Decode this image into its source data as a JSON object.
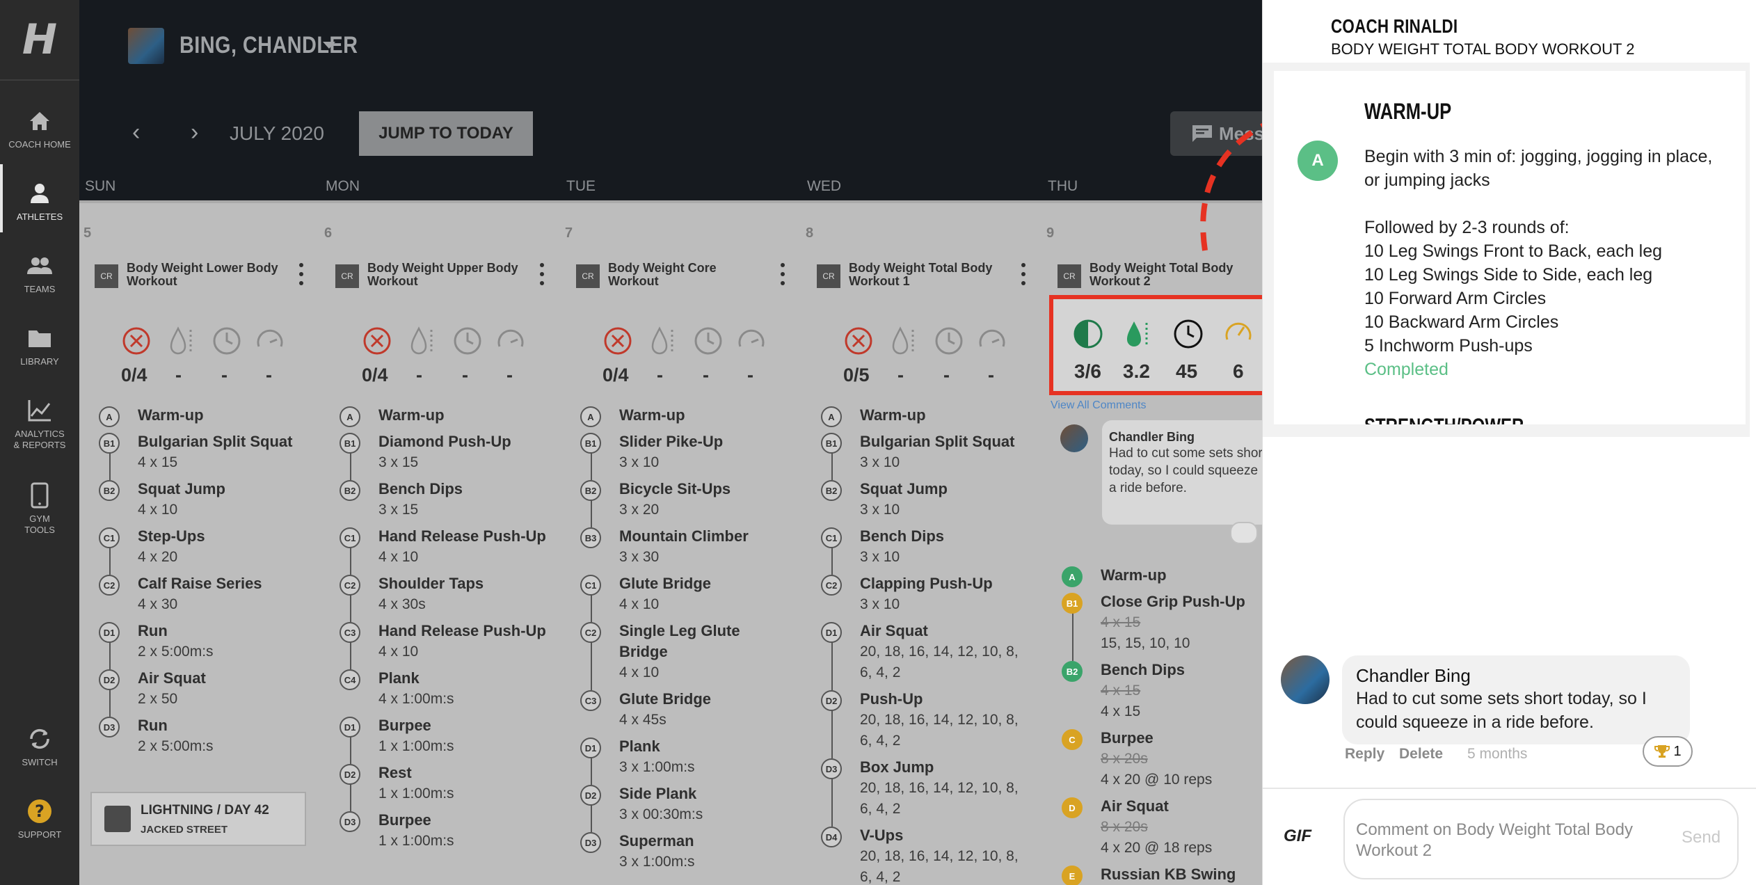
{
  "sidebar": {
    "logo": "H",
    "items": [
      {
        "label_1": "COACH HOME",
        "label_2": ""
      },
      {
        "label_1": "ATHLETES",
        "label_2": ""
      },
      {
        "label_1": "TEAMS",
        "label_2": ""
      },
      {
        "label_1": "LIBRARY",
        "label_2": ""
      },
      {
        "label_1": "ANALYTICS",
        "label_2": "& REPORTS"
      },
      {
        "label_1": "GYM",
        "label_2": "TOOLS"
      },
      {
        "label_1": "SWITCH",
        "label_2": ""
      },
      {
        "label_1": "SUPPORT",
        "label_2": ""
      }
    ]
  },
  "header": {
    "athlete_name": "BING, CHANDLER",
    "month": "JULY 2020",
    "prev_icon": "‹",
    "next_icon": "›",
    "jump_label": "JUMP TO TODAY",
    "message_label": "Mess"
  },
  "days": [
    "SUN",
    "MON",
    "TUE",
    "WED",
    "THU"
  ],
  "columns": [
    {
      "date": "5",
      "badge": "CR",
      "title": "Body Weight Lower Body Workout",
      "stats": [
        "0/4",
        "-",
        "-",
        "-"
      ],
      "exercises": [
        {
          "id": "A",
          "name": "Warm-up",
          "sets": ""
        },
        {
          "id": "B1",
          "name": "Bulgarian Split Squat",
          "sets": "4 x 15"
        },
        {
          "id": "B2",
          "name": "Squat Jump",
          "sets": "4 x 10"
        },
        {
          "id": "C1",
          "name": "Step-Ups",
          "sets": "4 x 20"
        },
        {
          "id": "C2",
          "name": "Calf Raise Series",
          "sets": "4 x 30"
        },
        {
          "id": "D1",
          "name": "Run",
          "sets": "2 x 5:00m:s"
        },
        {
          "id": "D2",
          "name": "Air Squat",
          "sets": "2 x 50"
        },
        {
          "id": "D3",
          "name": "Run",
          "sets": "2 x 5:00m:s"
        }
      ],
      "program": {
        "line1": "LIGHTNING / DAY 42",
        "line2": "JACKED STREET"
      }
    },
    {
      "date": "6",
      "badge": "CR",
      "title": "Body Weight Upper Body Workout",
      "stats": [
        "0/4",
        "-",
        "-",
        "-"
      ],
      "exercises": [
        {
          "id": "A",
          "name": "Warm-up",
          "sets": ""
        },
        {
          "id": "B1",
          "name": "Diamond Push-Up",
          "sets": "3 x 15"
        },
        {
          "id": "B2",
          "name": "Bench Dips",
          "sets": "3 x 15"
        },
        {
          "id": "C1",
          "name": "Hand Release Push-Up",
          "sets": "4 x 10"
        },
        {
          "id": "C2",
          "name": "Shoulder Taps",
          "sets": "4 x 30s"
        },
        {
          "id": "C3",
          "name": "Hand Release Push-Up",
          "sets": "4 x 10"
        },
        {
          "id": "C4",
          "name": "Plank",
          "sets": "4 x 1:00m:s"
        },
        {
          "id": "D1",
          "name": "Burpee",
          "sets": "1 x 1:00m:s"
        },
        {
          "id": "D2",
          "name": "Rest",
          "sets": "1 x 1:00m:s"
        },
        {
          "id": "D3",
          "name": "Burpee",
          "sets": "1 x 1:00m:s"
        }
      ]
    },
    {
      "date": "7",
      "badge": "CR",
      "title": "Body Weight Core Workout",
      "stats": [
        "0/4",
        "-",
        "-",
        "-"
      ],
      "exercises": [
        {
          "id": "A",
          "name": "Warm-up",
          "sets": ""
        },
        {
          "id": "B1",
          "name": "Slider Pike-Up",
          "sets": "3 x 10"
        },
        {
          "id": "B2",
          "name": "Bicycle Sit-Ups",
          "sets": "3 x 20"
        },
        {
          "id": "B3",
          "name": "Mountain Climber",
          "sets": "3 x 30"
        },
        {
          "id": "C1",
          "name": "Glute Bridge",
          "sets": "4 x 10"
        },
        {
          "id": "C2",
          "name": "Single Leg Glute Bridge",
          "sets": "4 x 10"
        },
        {
          "id": "C3",
          "name": "Glute Bridge",
          "sets": "4 x 45s"
        },
        {
          "id": "D1",
          "name": "Plank",
          "sets": "3 x 1:00m:s"
        },
        {
          "id": "D2",
          "name": "Side Plank",
          "sets": "3 x 00:30m:s"
        },
        {
          "id": "D3",
          "name": "Superman",
          "sets": "3 x 1:00m:s"
        }
      ]
    },
    {
      "date": "8",
      "badge": "CR",
      "title": "Body Weight Total Body Workout 1",
      "stats": [
        "0/5",
        "-",
        "-",
        "-"
      ],
      "exercises": [
        {
          "id": "A",
          "name": "Warm-up",
          "sets": ""
        },
        {
          "id": "B1",
          "name": "Bulgarian Split Squat",
          "sets": "3 x 10"
        },
        {
          "id": "B2",
          "name": "Squat Jump",
          "sets": "3 x 10"
        },
        {
          "id": "C1",
          "name": "Bench Dips",
          "sets": "3 x 10"
        },
        {
          "id": "C2",
          "name": "Clapping Push-Up",
          "sets": "3 x 10"
        },
        {
          "id": "D1",
          "name": "Air Squat",
          "sets": "20, 18, 16, 14, 12, 10, 8, 6, 4, 2"
        },
        {
          "id": "D2",
          "name": "Push-Up",
          "sets": "20, 18, 16, 14, 12, 10, 8, 6, 4, 2"
        },
        {
          "id": "D3",
          "name": "Box Jump",
          "sets": "20, 18, 16, 14, 12, 10, 8, 6, 4, 2"
        },
        {
          "id": "D4",
          "name": "V-Ups",
          "sets": "20, 18, 16, 14, 12, 10, 8, 6, 4, 2"
        }
      ]
    },
    {
      "date": "9",
      "badge": "CR",
      "title": "Body Weight Total Body Workout 2",
      "stats": [
        "3/6",
        "3.2",
        "45",
        "6"
      ],
      "view_comments": "View All Comments",
      "mini_comment": {
        "who": "Chandler Bing",
        "text": "Had to cut some sets short today, so I could squeeze in a ride before."
      },
      "exercises": [
        {
          "id": "A",
          "name": "Warm-up",
          "sets": "",
          "color": "#3aa46a"
        },
        {
          "id": "B1",
          "name": "Close Grip Push-Up",
          "sets_struck": "4 x 15",
          "sets": "15, 15, 10, 10",
          "color": "#d9a323"
        },
        {
          "id": "B2",
          "name": "Bench Dips",
          "sets_struck": "4 x 15",
          "sets": "4 x 15",
          "color": "#3aa46a"
        },
        {
          "id": "C",
          "name": "Burpee",
          "sets_struck": "8 x 20s",
          "sets": "4 x 20 @ 10 reps",
          "color": "#d9a323"
        },
        {
          "id": "D",
          "name": "Air Squat",
          "sets_struck": "8 x 20s",
          "sets": "4 x 20 @ 18 reps",
          "color": "#d9a323"
        },
        {
          "id": "E",
          "name": "Russian KB Swing",
          "sets": "",
          "color": "#d9a323"
        }
      ]
    }
  ],
  "panel": {
    "coach": "COACH RINALDI",
    "workout": "BODY WEIGHT TOTAL BODY WORKOUT 2",
    "section_title": "WARM-UP",
    "section_badge": "A",
    "lines": [
      "Begin with 3 min of: jogging, jogging in place, or jumping jacks",
      "Followed by 2-3 rounds of:",
      "10 Leg Swings Front to Back, each leg",
      "10 Leg Swings Side to Side, each leg",
      "10 Forward Arm Circles",
      "10 Backward Arm Circles",
      "5 Inchworm Push-ups"
    ],
    "status": "Completed",
    "next_section": "STRENGTH/POWER",
    "comment": {
      "who": "Chandler  Bing",
      "text": "Had to cut some sets short today, so I could squeeze in a ride before.",
      "reply": "Reply",
      "delete": "Delete",
      "time": "5 months",
      "trophy_count": "1"
    },
    "composer": {
      "gif": "GIF",
      "placeholder": "Comment on Body Weight Total Body Workout 2",
      "send": "Send"
    }
  },
  "colors": {
    "annotation_red": "#e63222",
    "completed_green": "#5bbf86",
    "partial_gold": "#d9a323",
    "link_blue": "#4e86c6"
  }
}
